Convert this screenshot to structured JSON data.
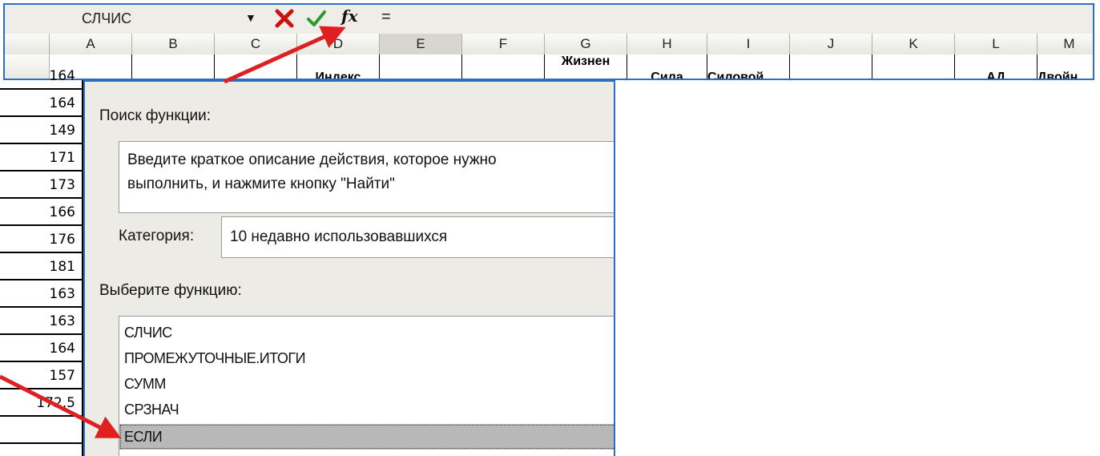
{
  "formula_bar": {
    "name_box_value": "СЛЧИС",
    "dropdown_icon": "triangle-down-icon",
    "cancel_icon": "x-icon",
    "enter_icon": "checkmark-icon",
    "fx_label": "fx",
    "formula_value": "="
  },
  "columns": [
    "A",
    "B",
    "C",
    "D",
    "E",
    "F",
    "G",
    "H",
    "I",
    "J",
    "K",
    "L",
    "M"
  ],
  "selected_column": "E",
  "header_row": {
    "D": "Индекс",
    "G": "Жизнен",
    "H": "Сила",
    "I": "Силовой",
    "L": "АД",
    "M": "Двойн"
  },
  "row_values": [
    "164",
    "164",
    "149",
    "171",
    "173",
    "166",
    "176",
    "181",
    "163",
    "163",
    "164",
    "157",
    "172,5"
  ],
  "dialog": {
    "search_label": "Поиск функции:",
    "search_text_line1": "Введите краткое описание действия, которое нужно",
    "search_text_line2": "выполнить, и нажмите кнопку \"Найти\"",
    "category_label": "Категория:",
    "category_value": "10 недавно использовавшихся",
    "choose_label": "Выберите функцию:",
    "functions": [
      "СЛЧИС",
      "ПРОМЕЖУТОЧНЫЕ.ИТОГИ",
      "СУММ",
      "СРЗНАЧ",
      "ЕСЛИ"
    ],
    "selected_function": "ЕСЛИ"
  },
  "colors": {
    "border_blue": "#2a6fc0",
    "arrow_red": "#e02020",
    "cancel_red": "#cc1111",
    "enter_green": "#2a9a2a"
  }
}
